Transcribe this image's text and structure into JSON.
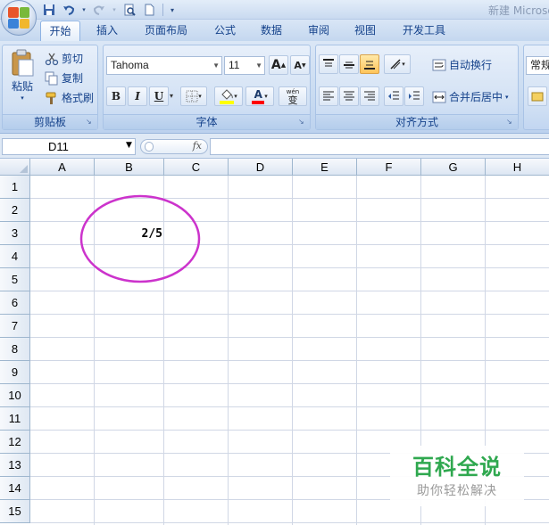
{
  "window": {
    "title": "新建 Microsoft Office Excel 工作表.xlsx - Microsoft Excel"
  },
  "quick_access": [
    "save-icon",
    "undo-icon",
    "redo-icon",
    "print-preview-icon",
    "new-icon"
  ],
  "tabs": [
    {
      "label": "开始",
      "active": true
    },
    {
      "label": "插入"
    },
    {
      "label": "页面布局"
    },
    {
      "label": "公式"
    },
    {
      "label": "数据"
    },
    {
      "label": "审阅"
    },
    {
      "label": "视图"
    },
    {
      "label": "开发工具"
    }
  ],
  "ribbon": {
    "clipboard": {
      "label": "剪贴板",
      "paste": "粘贴",
      "cut": "剪切",
      "copy": "复制",
      "format_painter": "格式刷"
    },
    "font": {
      "label": "字体",
      "font_name": "Tahoma",
      "font_size": "11",
      "bold": "B",
      "italic": "I",
      "underline": "U",
      "grow": "A",
      "shrink": "A",
      "color_letter": "A",
      "pinyin": "wén",
      "pinyin_char": "变",
      "fill_color": "#ffff00",
      "font_color": "#ff0000"
    },
    "alignment": {
      "label": "对齐方式",
      "wrap_text": "自动换行",
      "merge_center": "合并后居中"
    },
    "number": {
      "format": "常规"
    }
  },
  "formula_bar": {
    "name_box": "D11",
    "fx": "fx",
    "formula": ""
  },
  "sheet": {
    "columns": [
      "A",
      "B",
      "C",
      "D",
      "E",
      "F",
      "G",
      "H"
    ],
    "rows": [
      "1",
      "2",
      "3",
      "4",
      "5",
      "6",
      "7",
      "8",
      "9",
      "10",
      "11",
      "12",
      "13",
      "14",
      "15"
    ],
    "cells": {
      "B3": "2/5"
    },
    "annotation_color": "#cc33cc"
  },
  "watermark": {
    "title": "百科全说",
    "subtitle": "助你轻松解决"
  }
}
